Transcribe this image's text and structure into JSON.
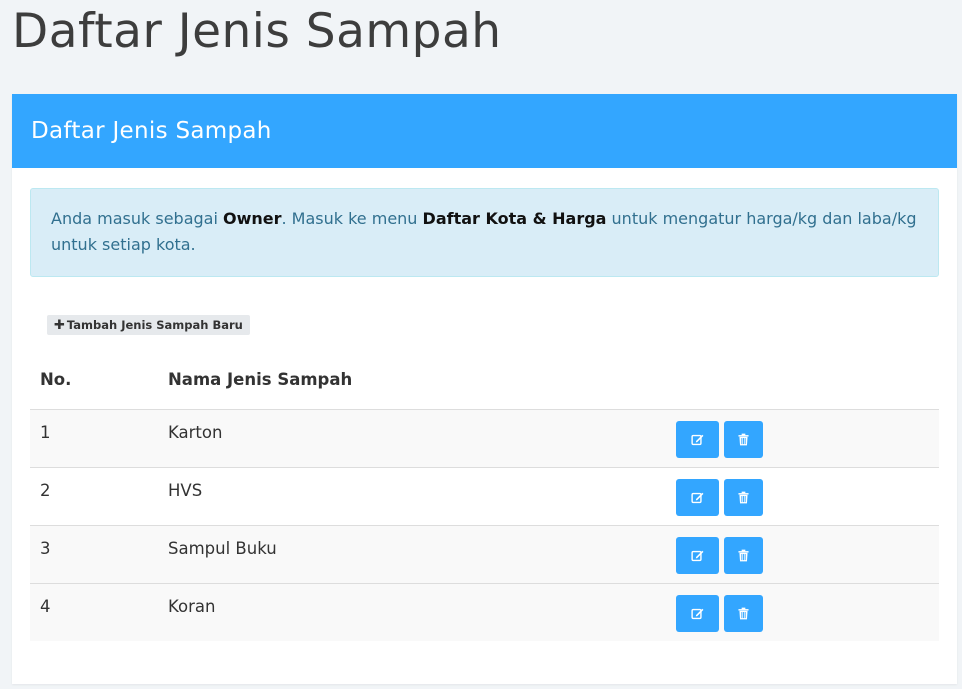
{
  "page": {
    "title": "Daftar Jenis Sampah"
  },
  "panel": {
    "heading": "Daftar Jenis Sampah"
  },
  "alert": {
    "text_1": "Anda masuk sebagai ",
    "role": "Owner",
    "text_2": ". Masuk ke menu ",
    "menu": "Daftar Kota & Harga",
    "text_3": " untuk mengatur harga/kg dan laba/kg untuk setiap kota."
  },
  "add_button": {
    "icon": "plus-icon",
    "label": "Tambah Jenis Sampah Baru"
  },
  "table": {
    "headers": [
      "No.",
      "Nama Jenis Sampah",
      ""
    ],
    "rows": [
      {
        "no": "1",
        "name": "Karton"
      },
      {
        "no": "2",
        "name": "HVS"
      },
      {
        "no": "3",
        "name": "Sampul Buku"
      },
      {
        "no": "4",
        "name": "Koran"
      }
    ],
    "actions": {
      "edit_icon": "edit-icon",
      "delete_icon": "trash-icon"
    }
  },
  "colors": {
    "primary": "#33a6ff",
    "background": "#f1f4f7",
    "alert_bg": "#d9edf7",
    "alert_text": "#31708f"
  }
}
